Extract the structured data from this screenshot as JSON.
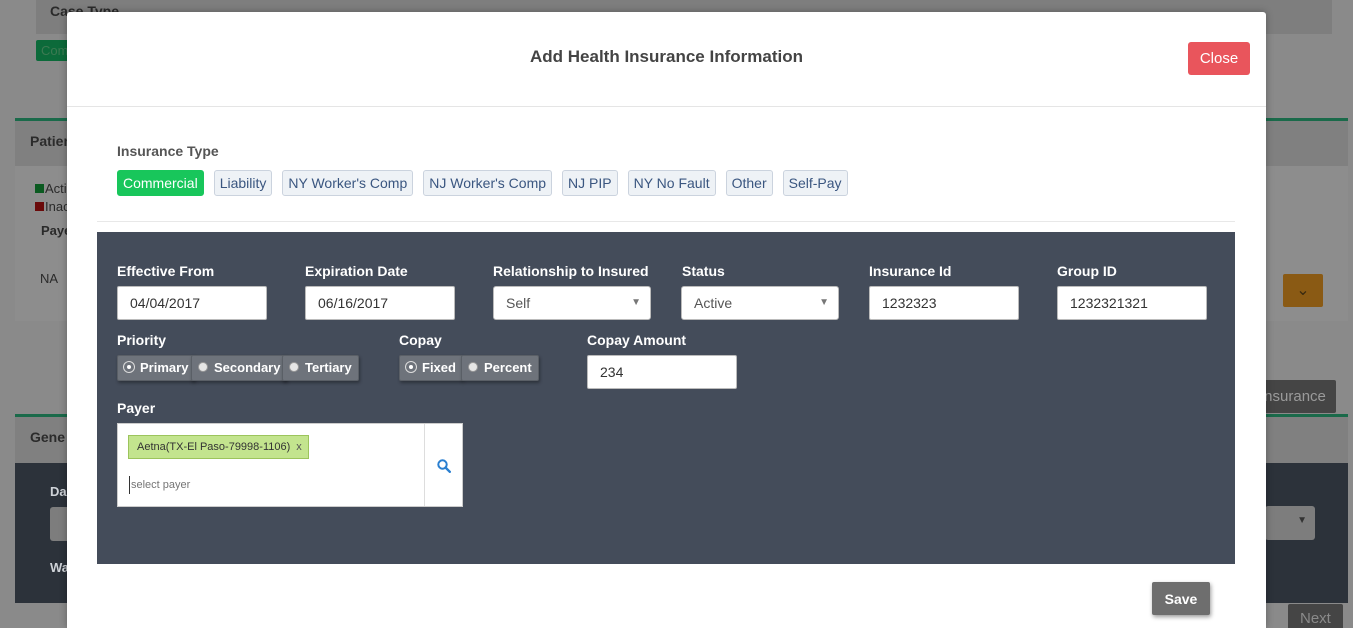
{
  "background": {
    "case_type_heading": "Case Type",
    "case_type_badge": "Com",
    "patient_heading": "Patien",
    "legend_active": "Acti",
    "legend_inactive": "Inac",
    "payer_col": "Paye",
    "row_value": "NA",
    "add_insurance_btn": "Insurance",
    "general_heading": "Gene",
    "date_label": "Da",
    "wa_label": "Wa",
    "next_btn": "Next"
  },
  "modal": {
    "title": "Add Health Insurance Information",
    "close_label": "Close",
    "save_label": "Save"
  },
  "insurance_type": {
    "label": "Insurance Type",
    "options": [
      "Commercial",
      "Liability",
      "NY Worker's Comp",
      "NJ Worker's Comp",
      "NJ PIP",
      "NY No Fault",
      "Other",
      "Self-Pay"
    ],
    "selected": "Commercial"
  },
  "form": {
    "effective_from": {
      "label": "Effective From",
      "value": "04/04/2017"
    },
    "expiration_date": {
      "label": "Expiration Date",
      "value": "06/16/2017"
    },
    "relationship": {
      "label": "Relationship to Insured",
      "value": "Self"
    },
    "status": {
      "label": "Status",
      "value": "Active"
    },
    "insurance_id": {
      "label": "Insurance Id",
      "value": "1232323"
    },
    "group_id": {
      "label": "Group ID",
      "value": "1232321321"
    },
    "priority": {
      "label": "Priority",
      "options": [
        "Primary",
        "Secondary",
        "Tertiary"
      ],
      "selected": "Primary"
    },
    "copay": {
      "label": "Copay",
      "options": [
        "Fixed",
        "Percent"
      ],
      "selected": "Fixed"
    },
    "copay_amount": {
      "label": "Copay Amount",
      "value": "234"
    },
    "payer": {
      "label": "Payer",
      "selected_tag": "Aetna(TX-El Paso-79998-1106)",
      "remove_symbol": "x",
      "placeholder": "select payer"
    }
  },
  "colors": {
    "accent_green": "#18c65b",
    "close_red": "#e9555c",
    "form_panel": "#444c5a",
    "payer_tag": "#c3e48e",
    "search_icon": "#2a7fd0"
  },
  "icons": {
    "payer_search": "search-icon",
    "select_caret": "caret-down-icon"
  }
}
